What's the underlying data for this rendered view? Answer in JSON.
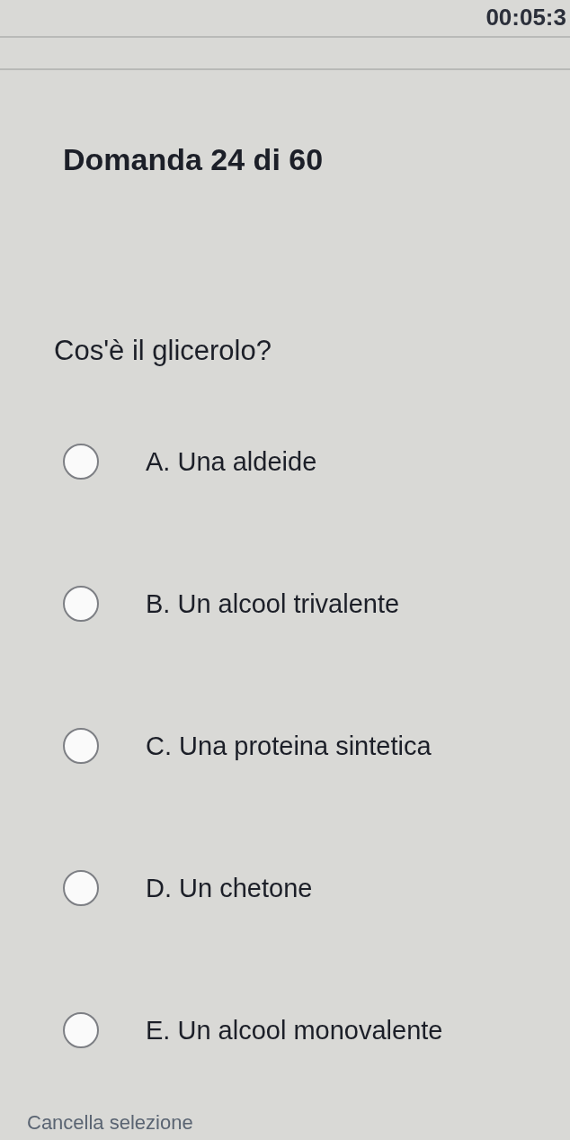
{
  "timer": "00:05:3",
  "question": {
    "title": "Domanda 24 di 60",
    "text": "Cos'è il glicerolo?",
    "options": [
      {
        "letter": "A.",
        "label": "Una aldeide",
        "selected": false
      },
      {
        "letter": "B.",
        "label": "Un alcool trivalente",
        "selected": false
      },
      {
        "letter": "C.",
        "label": "Una proteina sintetica",
        "selected": false
      },
      {
        "letter": "D.",
        "label": "Un chetone",
        "selected": false
      },
      {
        "letter": "E.",
        "label": "Un alcool monovalente",
        "selected": false
      }
    ],
    "clear_link": "Cancella selezione"
  }
}
